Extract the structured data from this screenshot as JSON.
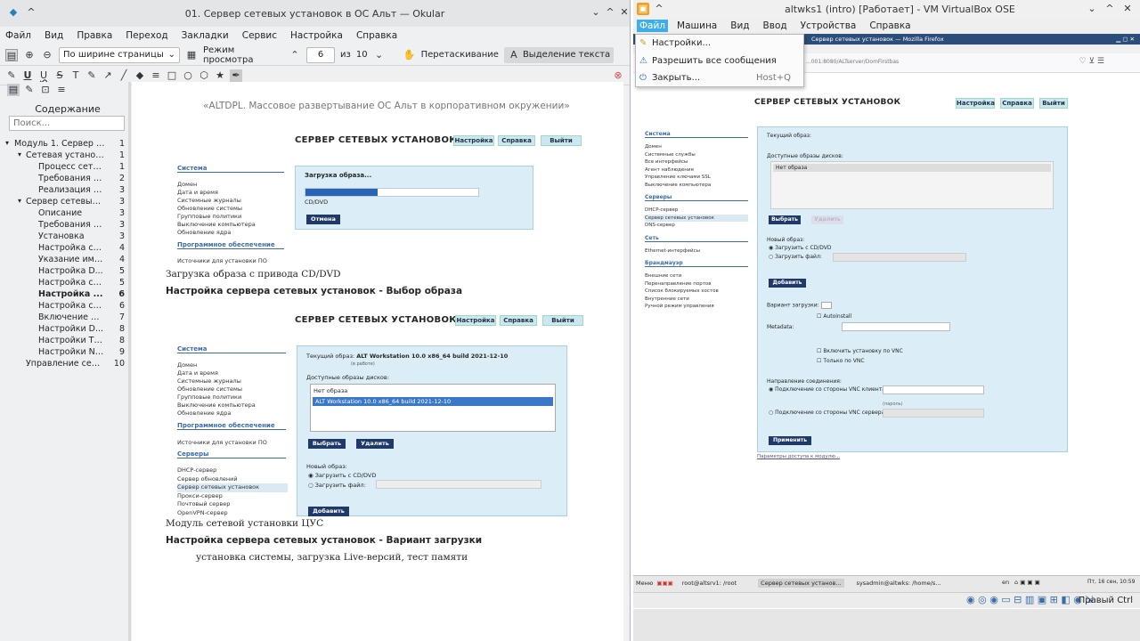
{
  "okular": {
    "title": "01. Сервер сетевых установок в ОС Альт — Okular",
    "menu": [
      "Файл",
      "Вид",
      "Правка",
      "Переход",
      "Закладки",
      "Сервис",
      "Настройка",
      "Справка"
    ],
    "zoom_mode": "По ширине страницы",
    "view_mode": "Режим просмотра",
    "page_current": "6",
    "page_of": "из",
    "page_total": "10",
    "drag_label": "Перетаскивание",
    "select_label": "Выделение текста",
    "sidebar_title": "Содержание",
    "search_placeholder": "Поиск...",
    "toc": [
      {
        "label": "Модуль 1. Сервер се...",
        "page": "1",
        "level": 0,
        "exp": "▾"
      },
      {
        "label": "Сетевая установка",
        "page": "1",
        "level": 1,
        "exp": "▾"
      },
      {
        "label": "Процесс сете...",
        "page": "1",
        "level": 2,
        "exp": ""
      },
      {
        "label": "Требования д...",
        "page": "2",
        "level": 2,
        "exp": ""
      },
      {
        "label": "Реализация с...",
        "page": "3",
        "level": 2,
        "exp": ""
      },
      {
        "label": "Сервер сетевых ...",
        "page": "3",
        "level": 1,
        "exp": "▾"
      },
      {
        "label": "Описание",
        "page": "3",
        "level": 2,
        "exp": ""
      },
      {
        "label": "Требования к...",
        "page": "3",
        "level": 2,
        "exp": ""
      },
      {
        "label": "Установка",
        "page": "3",
        "level": 2,
        "exp": ""
      },
      {
        "label": "Настройка ст...",
        "page": "4",
        "level": 2,
        "exp": ""
      },
      {
        "label": "Указание име...",
        "page": "4",
        "level": 2,
        "exp": ""
      },
      {
        "label": "Настройка D...",
        "page": "5",
        "level": 2,
        "exp": ""
      },
      {
        "label": "Настройка се...",
        "page": "5",
        "level": 2,
        "exp": ""
      },
      {
        "label": "Настройка ...",
        "page": "6",
        "level": 2,
        "exp": "",
        "bold": true
      },
      {
        "label": "Настройка се...",
        "page": "6",
        "level": 2,
        "exp": ""
      },
      {
        "label": "Включение р...",
        "page": "7",
        "level": 2,
        "exp": ""
      },
      {
        "label": "Настройки D...",
        "page": "8",
        "level": 2,
        "exp": ""
      },
      {
        "label": "Настройки TF...",
        "page": "8",
        "level": 2,
        "exp": ""
      },
      {
        "label": "Настройки NF...",
        "page": "9",
        "level": 2,
        "exp": ""
      },
      {
        "label": "Управление сер...",
        "page": "10",
        "level": 1,
        "exp": ""
      }
    ],
    "doc": {
      "header": "«ALTDPL. Массовое развертывание ОС Альт в корпоративном окружении»",
      "caption1": "Загрузка образа с привода CD/DVD",
      "heading1": "Настройка сервера сетевых установок - Выбор образа",
      "caption2": "Модуль сетевой установки ЦУС",
      "heading2": "Настройка сервера сетевых установок - Вариант загрузки",
      "para": "установка системы, загрузка Live-версий, тест памяти"
    },
    "shot1": {
      "title": "СЕРВЕР СЕТЕВЫХ УСТАНОВОК",
      "btns": [
        "Настройка",
        "Справка",
        "Выйти"
      ],
      "nav_sys": "Система",
      "nav_items": [
        "Домен",
        "Дата и время",
        "Системные журналы",
        "Обновление системы",
        "Групповые политики",
        "Выключение компьютера",
        "Обновление ядра"
      ],
      "nav_sw": "Программное обеспечение",
      "nav_sw_items": [
        "Источники для установки ПО"
      ],
      "loading": "Загрузка образа...",
      "cd": "CD/DVD",
      "cancel": "Отмена",
      "progress": 0.42
    },
    "shot2": {
      "title": "СЕРВЕР СЕТЕВЫХ УСТАНОВОК",
      "btns": [
        "Настройка",
        "Справка",
        "Выйти"
      ],
      "nav_sys": "Система",
      "nav_items": [
        "Домен",
        "Дата и время",
        "Системные журналы",
        "Обновление системы",
        "Групповые политики",
        "Выключение компьютера",
        "Обновление ядра"
      ],
      "nav_sw": "Программное обеспечение",
      "nav_sw_items": [
        "Источники для установки ПО"
      ],
      "nav_srv": "Серверы",
      "nav_srv_items": [
        "DHCP-сервер",
        "Сервер обновлений",
        "Сервер сетевых установок",
        "Прокси-сервер",
        "Почтовый сервер",
        "OpenVPN-сервер"
      ],
      "current_label": "Текущий образ:",
      "current_value": "ALT Workstation 10.0 x86_64 build 2021-12-10",
      "current_sub": "(в работе)",
      "avail_label": "Доступные образы дисков:",
      "images": [
        "Нет образа",
        "ALT Workstation 10.0 x86_64 build 2021-12-10"
      ],
      "select_btn": "Выбрать",
      "delete_btn": "Удалить",
      "new_label": "Новый образ:",
      "opt_cd": "Загрузить с CD/DVD",
      "opt_file": "Загрузить файл:",
      "add_btn": "Добавить"
    }
  },
  "vbox": {
    "title": "altwks1 (intro) [Работает] - VM VirtualBox OSE",
    "menu": [
      "Файл",
      "Машина",
      "Вид",
      "Ввод",
      "Устройства",
      "Справка"
    ],
    "file_menu": [
      {
        "label": "Настройки...",
        "shortcut": "",
        "icon": "wrench-icon"
      },
      {
        "label": "Разрешить все сообщения",
        "shortcut": "",
        "icon": "warning-icon"
      },
      {
        "label": "Закрыть...",
        "shortcut": "Host+Q",
        "icon": "power-icon"
      }
    ],
    "ff_title": "Сервер сетевых установок — Mozilla Firefox",
    "ff_url": "...001:8080/ALTserver/DomFirstbas",
    "page": {
      "title": "СЕРВЕР СЕТЕВЫХ УСТАНОВОК",
      "btns": [
        "Настройка",
        "Справка",
        "Выйти"
      ],
      "nav": [
        {
          "sec": "Система",
          "items": [
            "Домен",
            "Системные службы",
            "Все интерфейсы",
            "Агент наблюдения",
            "Управление ключами SSL",
            "Выключение компьютера"
          ]
        },
        {
          "sec": "Серверы",
          "items": [
            "DHCP-сервер",
            "Сервер сетевых установок",
            "DNS-сервер"
          ]
        },
        {
          "sec": "Сеть",
          "items": [
            "Ethernet-интерфейсы"
          ]
        },
        {
          "sec": "Брандмауэр",
          "items": [
            "Внешние сети",
            "Перенаправление портов",
            "Список блокируемых хостов",
            "Внутренние сети",
            "Ручной режим управления"
          ]
        }
      ],
      "current": "Текущий образ:",
      "avail": "Доступные образы дисков:",
      "no_image": "Нет образа",
      "select": "Выбрать",
      "delete": "Удалить",
      "new": "Новый образ:",
      "opt_cd": "Загрузить с CD/DVD",
      "opt_file": "Загрузить файл:",
      "add": "Добавить",
      "variant": "Вариант загрузки:",
      "autoinstall": "Autoinstall",
      "metadata": "Metadata:",
      "vnc": "Включить установку по VNC",
      "vnc_only": "Только по VNC",
      "direction": "Направление соединения:",
      "from_client": "Подключение со стороны VNC клиента",
      "from_server": "Подключение со стороны VNC сервера",
      "password": "(пароль)",
      "apply": "Применить",
      "footer": "Параметры доступа к модулю..."
    },
    "taskbar": {
      "menu": "Меню",
      "t1": "root@altsrv1: /root",
      "t2": "Сервер сетевых установ...",
      "t3": "sysadmin@altwks: /home/s...",
      "lang": "en",
      "clock": "Пт, 16 сен, 10:59",
      "host_key": "Правый Ctrl"
    }
  },
  "colors": {
    "accent": "#3daee9",
    "dark_btn": "#1f3a6a",
    "panel": "#dbeef7"
  }
}
